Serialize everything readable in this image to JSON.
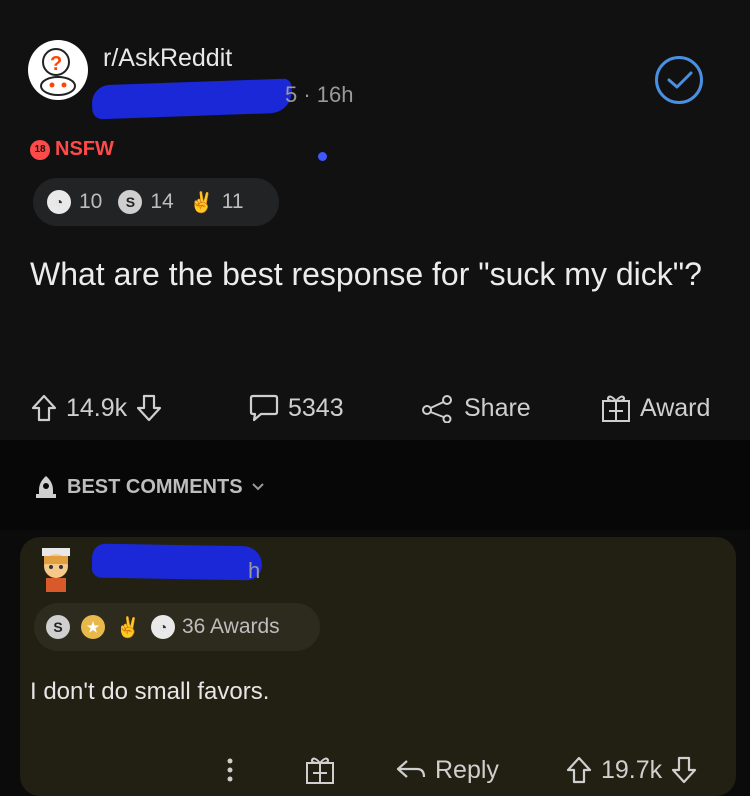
{
  "post": {
    "subreddit": "r/AskReddit",
    "meta": "5 · 16h",
    "nsfw_badge": "18",
    "nsfw_label": "NSFW",
    "awards": [
      {
        "icon": "wholesome-award-icon",
        "count": "10"
      },
      {
        "icon": "silver-award-icon",
        "count": "14"
      },
      {
        "icon": "helpful-award-icon",
        "count": "11"
      }
    ],
    "title": "What are the best response for \"suck my dick\"?",
    "upvotes": "14.9k",
    "comments": "5343",
    "share_label": "Share",
    "award_label": "Award"
  },
  "sort": {
    "label": "BEST COMMENTS"
  },
  "comment": {
    "meta": "h",
    "awards_label": "36 Awards",
    "text": "I don't do small favors.",
    "reply_label": "Reply",
    "upvotes": "19.7k"
  },
  "colors": {
    "accent_blue": "#4a90e2",
    "nsfw_red": "#ff4a4a",
    "redaction_blue": "#1a28d8"
  }
}
